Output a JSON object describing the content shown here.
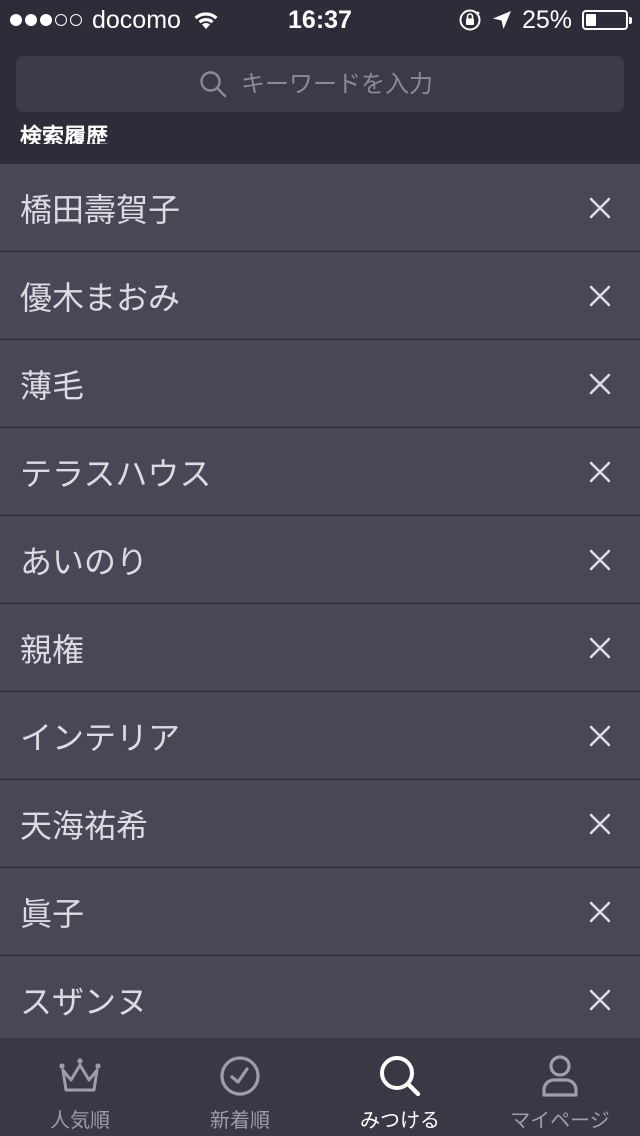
{
  "status_bar": {
    "carrier": "docomo",
    "time": "16:37",
    "battery": "25%",
    "battery_level": 0.25,
    "signal_bars_filled": 3,
    "signal_bars_total": 5
  },
  "search": {
    "placeholder": "キーワードを入力"
  },
  "history": {
    "title": "検索履歴",
    "items": [
      {
        "label": "橋田壽賀子"
      },
      {
        "label": "優木まおみ"
      },
      {
        "label": "薄毛"
      },
      {
        "label": "テラスハウス"
      },
      {
        "label": "あいのり"
      },
      {
        "label": "親権"
      },
      {
        "label": "インテリア"
      },
      {
        "label": "天海祐希"
      },
      {
        "label": "眞子"
      },
      {
        "label": "スザンヌ"
      }
    ]
  },
  "tabs": [
    {
      "label": "人気順",
      "icon": "crown-icon",
      "active": false
    },
    {
      "label": "新着順",
      "icon": "clock-icon",
      "active": false
    },
    {
      "label": "みつける",
      "icon": "search-icon",
      "active": true
    },
    {
      "label": "マイページ",
      "icon": "user-icon",
      "active": false
    }
  ],
  "colors": {
    "background": "#2d2c38",
    "list_background": "#484755",
    "tab_bar": "#393844",
    "inactive": "#9e9daa",
    "active": "#ffffff"
  }
}
